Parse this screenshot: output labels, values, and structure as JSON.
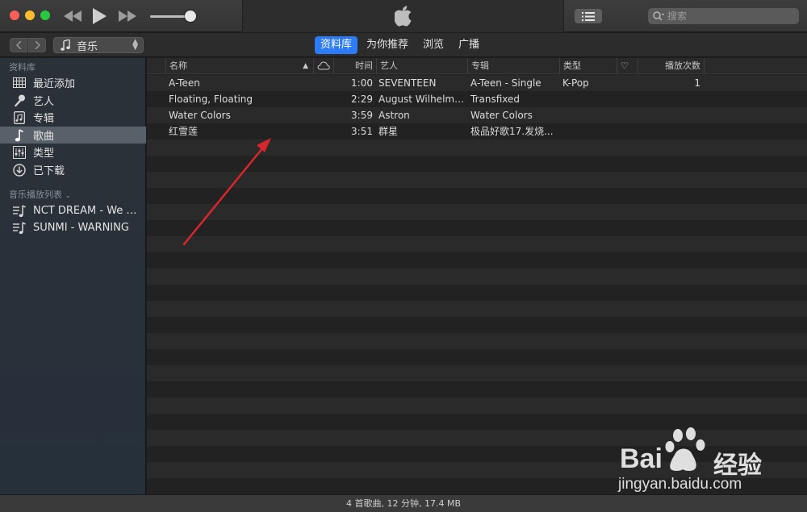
{
  "search": {
    "placeholder": "搜索"
  },
  "toolbar": {
    "media_type": "音乐"
  },
  "tabs": [
    {
      "label": "资料库",
      "active": true
    },
    {
      "label": "为你推荐",
      "active": false
    },
    {
      "label": "浏览",
      "active": false
    },
    {
      "label": "广播",
      "active": false
    }
  ],
  "sidebar": {
    "library_header": "资料库",
    "library_items": [
      {
        "label": "最近添加",
        "icon": "grid-icon",
        "selected": false
      },
      {
        "label": "艺人",
        "icon": "microphone-icon",
        "selected": false
      },
      {
        "label": "专辑",
        "icon": "album-icon",
        "selected": false
      },
      {
        "label": "歌曲",
        "icon": "music-note-icon",
        "selected": true
      },
      {
        "label": "类型",
        "icon": "genre-icon",
        "selected": false
      },
      {
        "label": "已下载",
        "icon": "download-icon",
        "selected": false
      }
    ],
    "playlists_header": "音乐播放列表",
    "playlists": [
      {
        "label": "NCT DREAM - We G...",
        "icon": "playlist-icon"
      },
      {
        "label": "SUNMI - WARNING",
        "icon": "playlist-icon"
      }
    ]
  },
  "table": {
    "columns": {
      "name": "名称",
      "time": "时间",
      "artist": "艺人",
      "album": "专辑",
      "genre": "类型",
      "plays": "播放次数"
    },
    "rows": [
      {
        "name": "A-Teen",
        "time": "1:00",
        "artist": "SEVENTEEN",
        "album": "A-Teen - Single",
        "genre": "K-Pop",
        "plays": "1"
      },
      {
        "name": "Floating, Floating",
        "time": "2:29",
        "artist": "August Wilhelms...",
        "album": "Transfixed",
        "genre": "",
        "plays": ""
      },
      {
        "name": "Water Colors",
        "time": "3:59",
        "artist": "Astron",
        "album": "Water Colors",
        "genre": "",
        "plays": ""
      },
      {
        "name": "红雪莲",
        "time": "3:51",
        "artist": "群星",
        "album": "极品好歌17.发烧...",
        "genre": "",
        "plays": ""
      }
    ]
  },
  "status": {
    "summary": "4 首歌曲, 12 分钟, 17.4 MB"
  },
  "watermark": {
    "brand": "Bai",
    "brand_cn": "经验",
    "url": "jingyan.baidu.com"
  },
  "colors": {
    "accent": "#2d7cf6",
    "arrow": "#d8262e",
    "selected_row": "#58606a"
  }
}
